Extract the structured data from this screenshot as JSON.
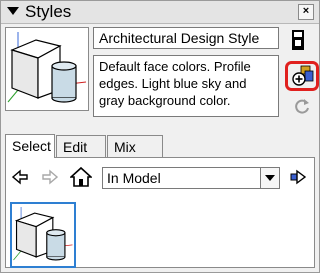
{
  "panel": {
    "title": "Styles",
    "close_glyph": "×"
  },
  "style": {
    "name": "Architectural Design Style",
    "description": "Default face colors. Profile edges. Light blue sky and gray background color."
  },
  "tabs": [
    {
      "label": "Select",
      "active": true
    },
    {
      "label": "Edit",
      "active": false
    },
    {
      "label": "Mix",
      "active": false
    }
  ],
  "collection": {
    "selected": "In Model"
  },
  "icons": {
    "collapse": "collapse-arrow-icon",
    "close": "close-icon",
    "save": "save-style-icon",
    "create": "create-new-style-icon",
    "update": "update-style-icon",
    "back": "back-arrow-icon",
    "forward": "forward-arrow-icon",
    "home": "home-icon",
    "details": "details-arrow-icon"
  },
  "colors": {
    "highlight_red": "#e0201e",
    "selection_blue": "#2e7fd2",
    "sky_blue": "#c9dbe6"
  }
}
